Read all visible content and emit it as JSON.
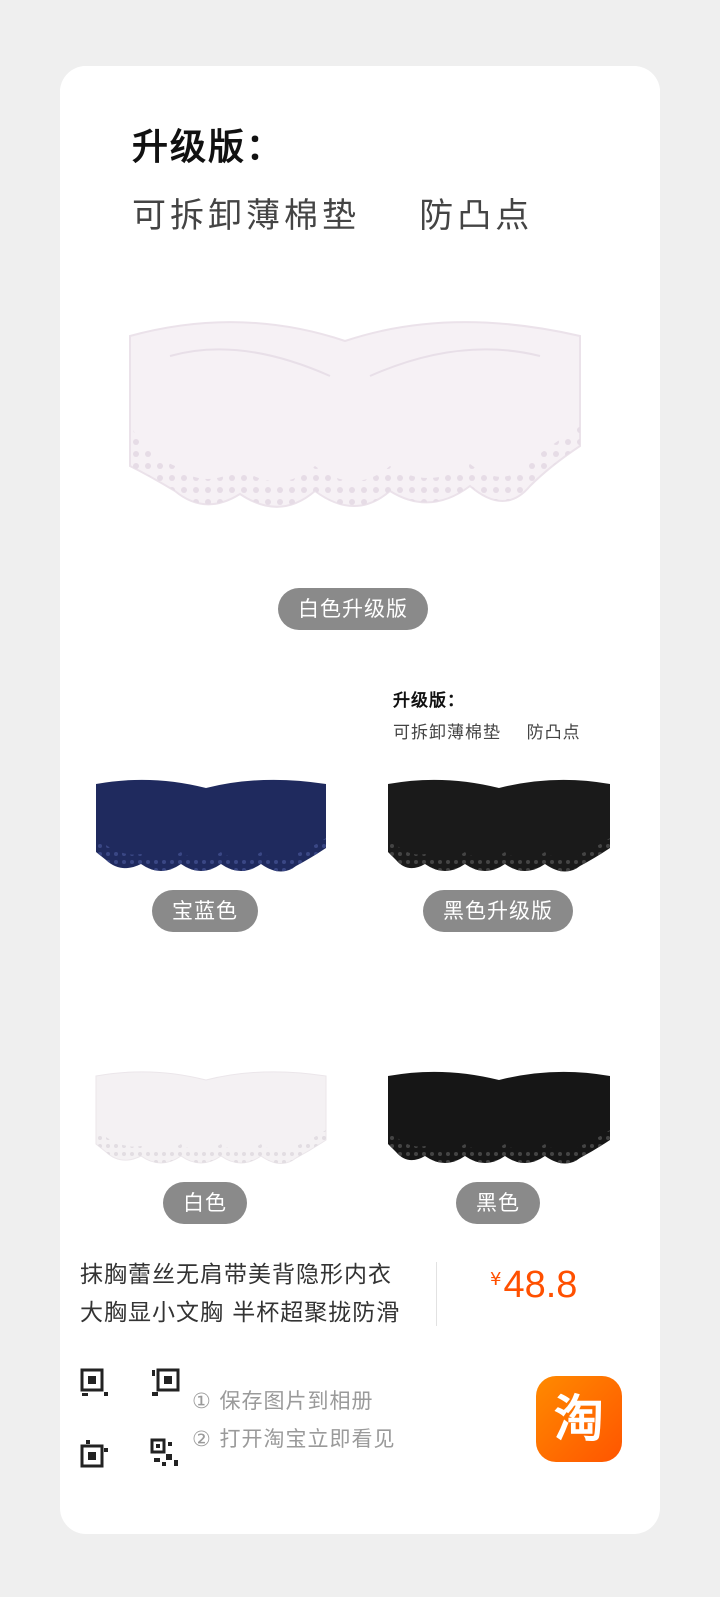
{
  "hero": {
    "title": "升级版：",
    "subtitle": "可拆卸薄棉垫    防凸点"
  },
  "labels": {
    "white_upgrade": "白色升级版",
    "royal_blue": "宝蓝色",
    "black_upgrade": "黑色升级版",
    "white": "白色",
    "black": "黑色"
  },
  "small_callout": {
    "title": "升级版：",
    "subtitle": "可拆卸薄棉垫    防凸点"
  },
  "product": {
    "title": "抹胸蕾丝无肩带美背隐形内衣 大胸显小文胸 半杯超聚拢防滑",
    "currency": "¥",
    "price": "48.8"
  },
  "steps": {
    "step1": "① 保存图片到相册",
    "step2": "② 打开淘宝立即看见"
  },
  "logo": {
    "glyph": "淘"
  },
  "colors": {
    "price": "#ff5000",
    "pill": "#8a8a8a",
    "logo": "#ff6a00",
    "variant_white": "#f3eef2",
    "variant_navy": "#1f2a5e",
    "variant_black": "#1a1a1a"
  }
}
